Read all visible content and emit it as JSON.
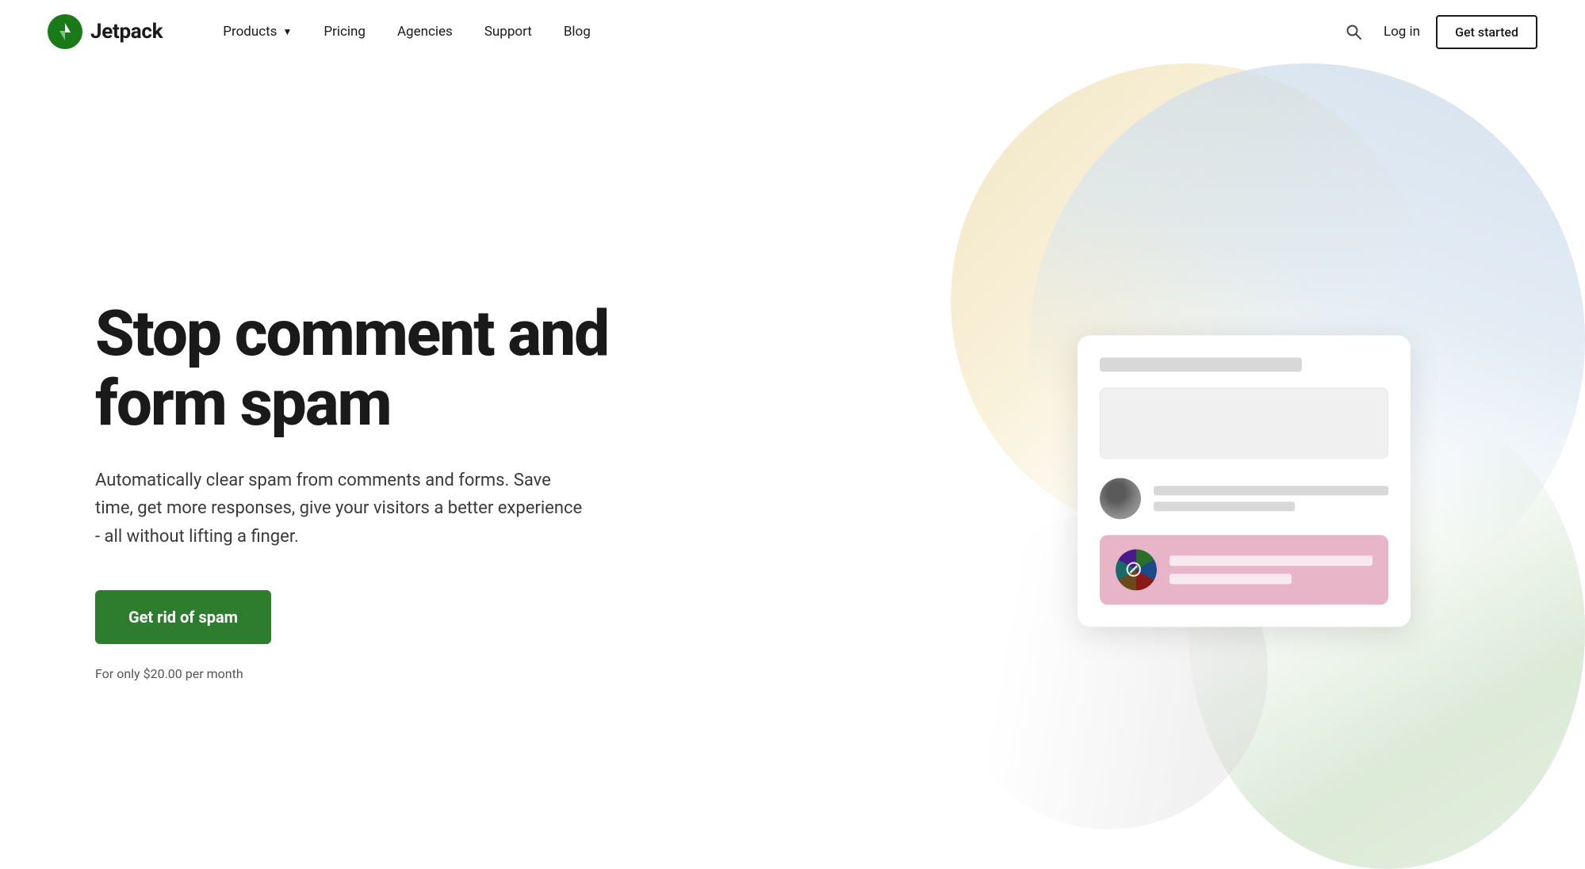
{
  "nav": {
    "logo_text": "Jetpack",
    "links": [
      {
        "label": "Products",
        "has_dropdown": true,
        "id": "products"
      },
      {
        "label": "Pricing",
        "has_dropdown": false,
        "id": "pricing"
      },
      {
        "label": "Agencies",
        "has_dropdown": false,
        "id": "agencies"
      },
      {
        "label": "Support",
        "has_dropdown": false,
        "id": "support"
      },
      {
        "label": "Blog",
        "has_dropdown": false,
        "id": "blog"
      }
    ],
    "login_label": "Log in",
    "get_started_label": "Get started",
    "search_aria": "Search"
  },
  "hero": {
    "title": "Stop comment and form spam",
    "description": "Automatically clear spam from comments and forms. Save time, get more responses, give your visitors a better experience - all without lifting a finger.",
    "cta_label": "Get rid of spam",
    "pricing_note": "For only $20.00 per month"
  },
  "colors": {
    "logo_bg": "#1a7a1a",
    "cta_bg": "#2e7d2e",
    "cta_text": "#ffffff",
    "get_started_border": "#1a1a1a"
  }
}
